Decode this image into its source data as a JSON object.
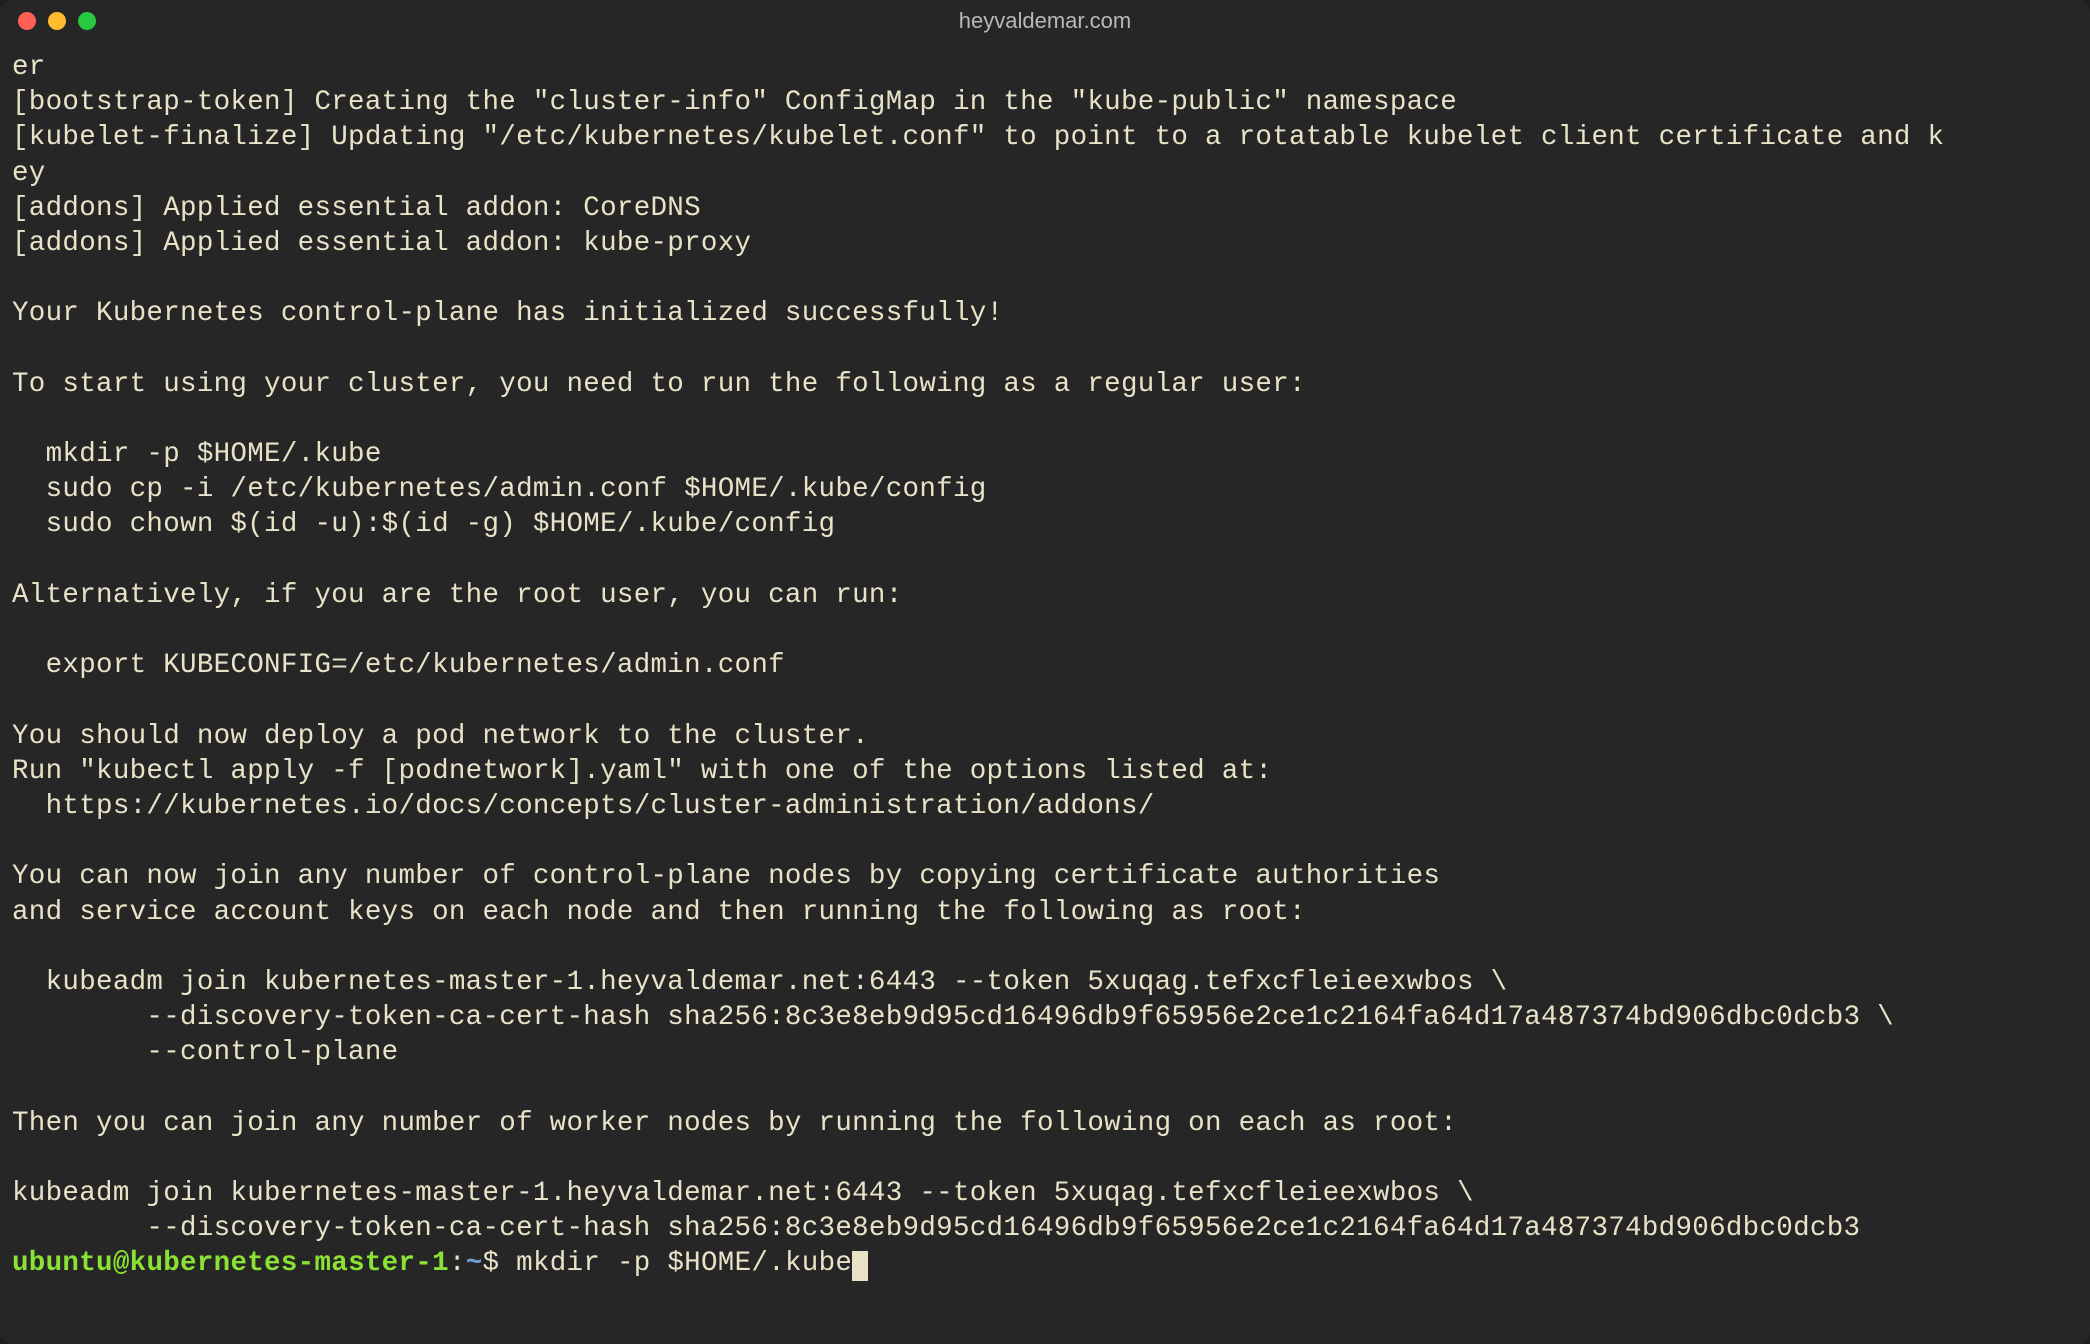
{
  "window": {
    "title": "heyvaldemar.com"
  },
  "terminal": {
    "lines": [
      "er",
      "[bootstrap-token] Creating the \"cluster-info\" ConfigMap in the \"kube-public\" namespace",
      "[kubelet-finalize] Updating \"/etc/kubernetes/kubelet.conf\" to point to a rotatable kubelet client certificate and k",
      "ey",
      "[addons] Applied essential addon: CoreDNS",
      "[addons] Applied essential addon: kube-proxy",
      "",
      "Your Kubernetes control-plane has initialized successfully!",
      "",
      "To start using your cluster, you need to run the following as a regular user:",
      "",
      "  mkdir -p $HOME/.kube",
      "  sudo cp -i /etc/kubernetes/admin.conf $HOME/.kube/config",
      "  sudo chown $(id -u):$(id -g) $HOME/.kube/config",
      "",
      "Alternatively, if you are the root user, you can run:",
      "",
      "  export KUBECONFIG=/etc/kubernetes/admin.conf",
      "",
      "You should now deploy a pod network to the cluster.",
      "Run \"kubectl apply -f [podnetwork].yaml\" with one of the options listed at:",
      "  https://kubernetes.io/docs/concepts/cluster-administration/addons/",
      "",
      "You can now join any number of control-plane nodes by copying certificate authorities",
      "and service account keys on each node and then running the following as root:",
      "",
      "  kubeadm join kubernetes-master-1.heyvaldemar.net:6443 --token 5xuqag.tefxcfleieexwbos \\",
      "        --discovery-token-ca-cert-hash sha256:8c3e8eb9d95cd16496db9f65956e2ce1c2164fa64d17a487374bd906dbc0dcb3 \\",
      "        --control-plane",
      "",
      "Then you can join any number of worker nodes by running the following on each as root:",
      "",
      "kubeadm join kubernetes-master-1.heyvaldemar.net:6443 --token 5xuqag.tefxcfleieexwbos \\",
      "        --discovery-token-ca-cert-hash sha256:8c3e8eb9d95cd16496db9f65956e2ce1c2164fa64d17a487374bd906dbc0dcb3"
    ],
    "prompt": {
      "user": "ubuntu",
      "host": "kubernetes-master-1",
      "path": "~",
      "command": "mkdir -p $HOME/.kube"
    }
  }
}
